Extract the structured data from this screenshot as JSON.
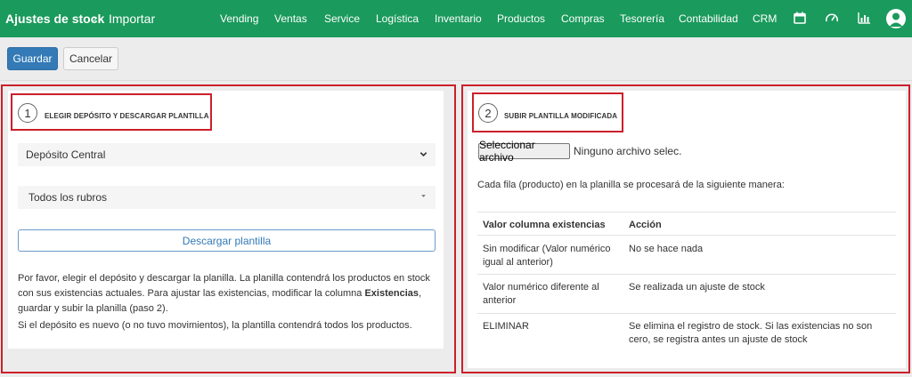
{
  "header": {
    "title": "Ajustes de stock",
    "separator": "›",
    "breadcrumb": "Importar",
    "nav": [
      "Vending",
      "Ventas",
      "Service",
      "Logística",
      "Inventario",
      "Productos",
      "Compras",
      "Tesorería",
      "Contabilidad",
      "CRM"
    ],
    "icons": [
      "calendar-icon",
      "speedometer-icon",
      "bar-chart-icon",
      "user-avatar-icon"
    ]
  },
  "toolbar": {
    "save_label": "Guardar",
    "cancel_label": "Cancelar"
  },
  "step1": {
    "number": "1",
    "title": "ELEGIR DEPÓSITO Y DESCARGAR PLANTILLA",
    "deposit_select": "Depósito Central",
    "category_select": "Todos los rubros",
    "download_label": "Descargar plantilla",
    "info_1a": "Por favor, elegir el depósito y descargar la planilla. La planilla contendrá los productos en stock con sus existencias actuales. Para ajustar las existencias, modificar la columna ",
    "info_1_bold": "Existencias",
    "info_1b": ", guardar y subir la planilla (paso 2).",
    "info_2": "Si el depósito es nuevo (o no tuvo movimientos), la plantilla contendrá todos los productos."
  },
  "step2": {
    "number": "2",
    "title": "SUBIR PLANTILLA MODIFICADA",
    "file_button": "Seleccionar archivo",
    "file_status": "Ninguno archivo selec.",
    "intro": "Cada fila (producto) en la planilla se procesará de la siguiente manera:",
    "table": {
      "headers": [
        "Valor columna existencias",
        "Acción"
      ],
      "rows": [
        [
          "Sin modificar (Valor numérico igual al anterior)",
          "No se hace nada"
        ],
        [
          "Valor numérico diferente al anterior",
          "Se realizada un ajuste de stock"
        ],
        [
          "ELIMINAR",
          "Se elimina el registro de stock. Si las existencias no son cero, se registra antes un ajuste de stock"
        ]
      ]
    }
  },
  "colors": {
    "nav_bg": "#1a9a5c",
    "primary": "#337ab7",
    "highlight": "#cc1f2a"
  }
}
